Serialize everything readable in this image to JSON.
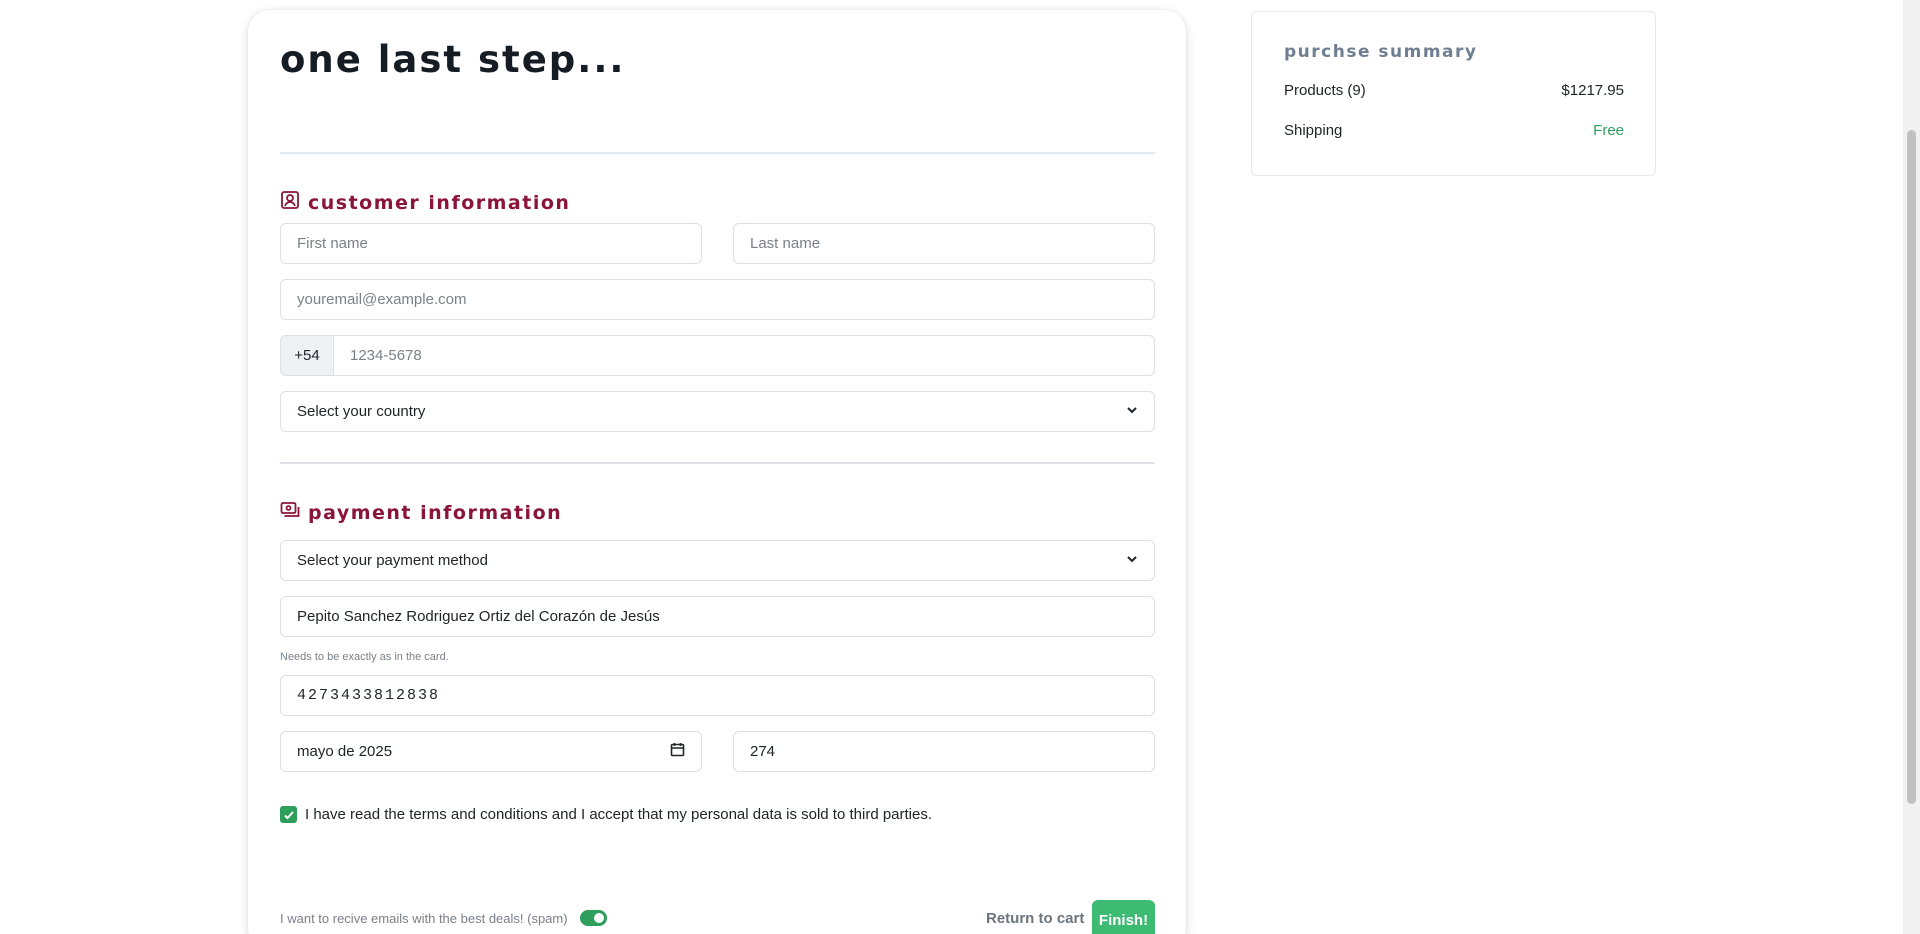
{
  "checkout": {
    "title": "one last step...",
    "customer_section": {
      "title": "customer information",
      "first_name_placeholder": "First name",
      "last_name_placeholder": "Last name",
      "email_placeholder": "youremail@example.com",
      "phone_prefix": "+54",
      "phone_placeholder": "1234-5678",
      "country_select": "Select your country"
    },
    "payment_section": {
      "title": "payment information",
      "method_select": "Select your payment method",
      "cardholder_name": "Pepito Sanchez Rodriguez Ortiz del Corazón de Jesús",
      "cardholder_hint": "Needs to be exactly as in the card.",
      "card_number": "4273433812838",
      "expiry": "mayo de 2025",
      "cvv": "274"
    },
    "terms_label": "I have read the terms and conditions and I accept that my personal data is sold to third parties.",
    "terms_checked": true,
    "newsletter_label": "I want to recive emails with the best deals! (spam)",
    "newsletter_on": true,
    "return_label": "Return to cart",
    "finish_label": "Finish!"
  },
  "summary": {
    "title": "purchse summary",
    "products_label": "Products (9)",
    "products_value": "$1217.95",
    "shipping_label": "Shipping",
    "shipping_value": "Free"
  },
  "colors": {
    "section_title": "#8a1538",
    "accent_green": "#3dbb73",
    "checkbox_green": "#2e9e5b"
  },
  "icons": {
    "customer_section": "contact-card-icon",
    "payment_section": "cash-icon",
    "select": "chevron-down-icon",
    "expiry": "calendar-icon",
    "terms": "checkmark-icon"
  }
}
